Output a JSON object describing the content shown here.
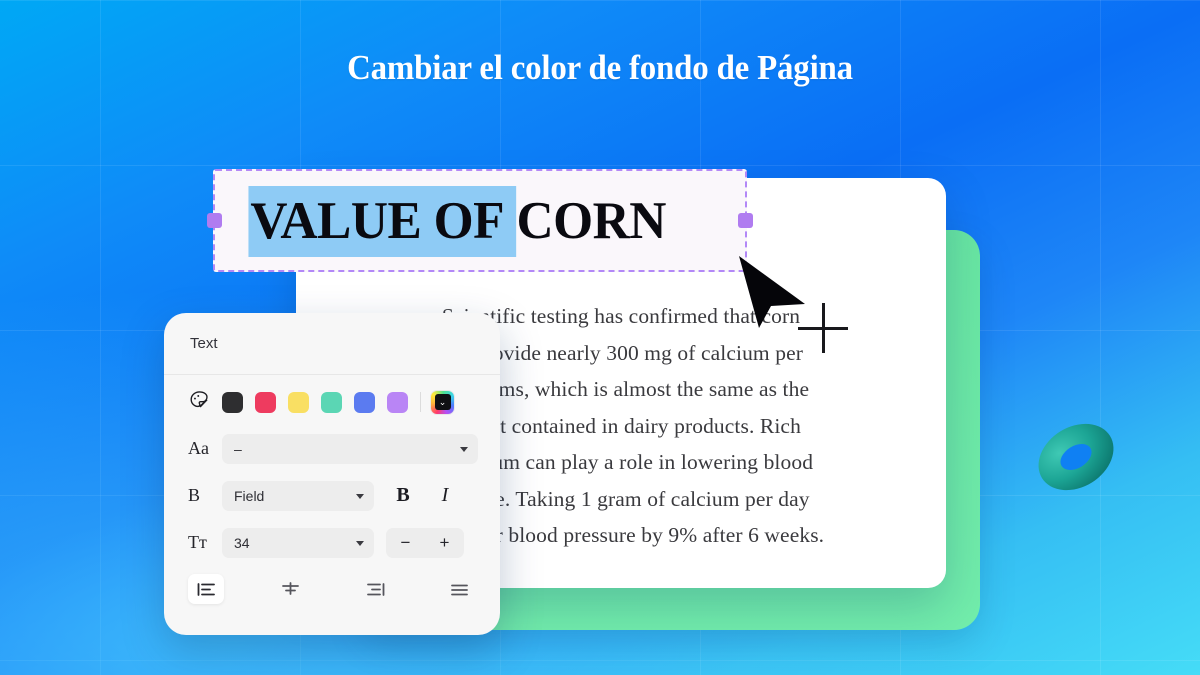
{
  "page": {
    "title": "Cambiar el color de fondo de Página",
    "background_colors": [
      "#00A8F5",
      "#0A6EF5",
      "#45DCF7"
    ],
    "green_card_color": "#6EE7A8",
    "torus_color": "#179C8C"
  },
  "heading_textbox": {
    "selected_text": "VALUE OF ",
    "unselected_text": "CORN",
    "selection_highlight_color": "#8ECBF5",
    "border_color": "#B388F7",
    "handle_color": "#B07CF0",
    "handle_left_name": "resize-handle-left",
    "handle_right_name": "resize-handle-right"
  },
  "document": {
    "lines": [
      "Scientific testing has confirmed that corn",
      "can provide nearly 300 mg of calcium per",
      "100 grams, which is almost the same as the",
      "amount contained in dairy products. Rich",
      "in calcium can play a role in lowering blood",
      "pressure. Taking 1 gram of calcium per day",
      "can lower blood pressure by 9% after 6 weeks."
    ]
  },
  "text_panel": {
    "header": "Text",
    "palette_icon": "paint-palette-icon",
    "colors": [
      {
        "name": "black",
        "hex": "#2E2E30"
      },
      {
        "name": "red",
        "hex": "#EE3B5F"
      },
      {
        "name": "yellow",
        "hex": "#F9DF63"
      },
      {
        "name": "teal",
        "hex": "#5BD6B4"
      },
      {
        "name": "blue",
        "hex": "#5B7BF0"
      },
      {
        "name": "purple",
        "hex": "#B985F5"
      }
    ],
    "custom_color_label": "⌄",
    "font_row": {
      "label": "Aa",
      "value": "–"
    },
    "style_row": {
      "label": "B",
      "value": "Field",
      "bold": "B",
      "italic": "I"
    },
    "size_row": {
      "label": "Tт",
      "value": "34",
      "minus": "−",
      "plus": "+"
    },
    "alignment": [
      {
        "name": "align-left",
        "active": true
      },
      {
        "name": "align-center",
        "active": false
      },
      {
        "name": "align-right",
        "active": false
      },
      {
        "name": "align-justify",
        "active": false
      }
    ]
  }
}
